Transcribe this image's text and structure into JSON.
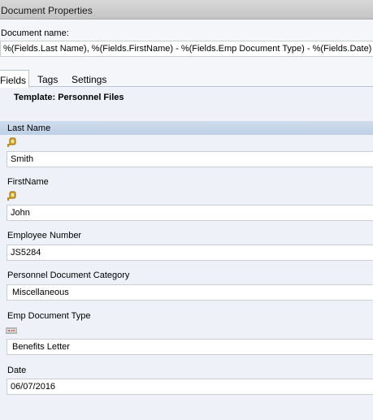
{
  "window": {
    "title": "Document Properties"
  },
  "document_name": {
    "label": "Document name:",
    "value": "%(Fields.Last Name), %(Fields.FirstName) - %(Fields.Emp Document Type) - %(Fields.Date)"
  },
  "tabs": [
    {
      "label": "Fields",
      "active": true
    },
    {
      "label": "Tags",
      "active": false
    },
    {
      "label": "Settings",
      "active": false
    }
  ],
  "template": {
    "label": "Template: Personnel Files"
  },
  "fields": [
    {
      "label": "Last Name",
      "value": "Smith",
      "icon": "lookup-key-icon"
    },
    {
      "label": "FirstName",
      "value": "John",
      "icon": "lookup-key-icon"
    },
    {
      "label": "Employee Number",
      "value": "JS5284"
    },
    {
      "label": "Personnel Document Category",
      "value": "Miscellaneous"
    },
    {
      "label": "Emp Document Type",
      "value": "Benefits Letter",
      "icon": "dropdown-list-icon"
    },
    {
      "label": "Date",
      "value": "06/07/2016"
    }
  ],
  "colors": {
    "selected_field_header": "#c6d6ea",
    "icon_gold": "#d8a21c"
  }
}
